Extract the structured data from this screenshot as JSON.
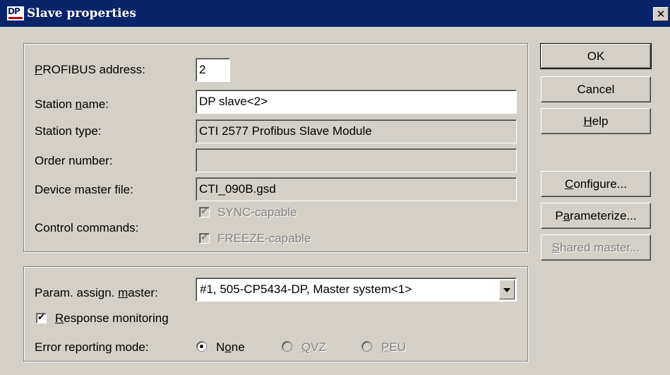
{
  "window": {
    "title": "Slave properties",
    "icon_text": "DP",
    "close_glyph": "✕"
  },
  "station": {
    "profibus_address_label": "PROFIBUS address:",
    "profibus_address_value": "2",
    "station_name_label": "Station name:",
    "station_name_value": "DP slave<2>",
    "station_type_label": "Station type:",
    "station_type_value": "CTI 2577 Profibus Slave Module",
    "order_number_label": "Order number:",
    "order_number_value": "",
    "device_master_file_label": "Device master file:",
    "device_master_file_value": "CTI_090B.gsd",
    "control_commands_label": "Control commands:",
    "sync_label": "SYNC-capable",
    "sync_checked": true,
    "freeze_label": "FREEZE-capable",
    "freeze_checked": true
  },
  "master": {
    "param_master_label": "Param. assign. master:",
    "param_master_value": "#1, 505-CP5434-DP, Master system<1>",
    "response_monitoring_label": "Response monitoring",
    "response_monitoring_checked": true,
    "error_mode_label": "Error reporting mode:",
    "error_modes": [
      {
        "label": "None",
        "selected": true,
        "enabled": true
      },
      {
        "label": "QVZ",
        "selected": false,
        "enabled": false
      },
      {
        "label": "PEU",
        "selected": false,
        "enabled": false
      }
    ]
  },
  "buttons": {
    "ok": "OK",
    "cancel": "Cancel",
    "help": "Help",
    "configure": "Configure...",
    "parameterize": "Parameterize...",
    "shared_master": "Shared master..."
  },
  "icons": {
    "check": "✔",
    "dropdown": "chevron-down-icon"
  },
  "colors": {
    "titlebar": "#0a246a",
    "face": "#d4d0c8",
    "disabled_text": "#808080"
  }
}
